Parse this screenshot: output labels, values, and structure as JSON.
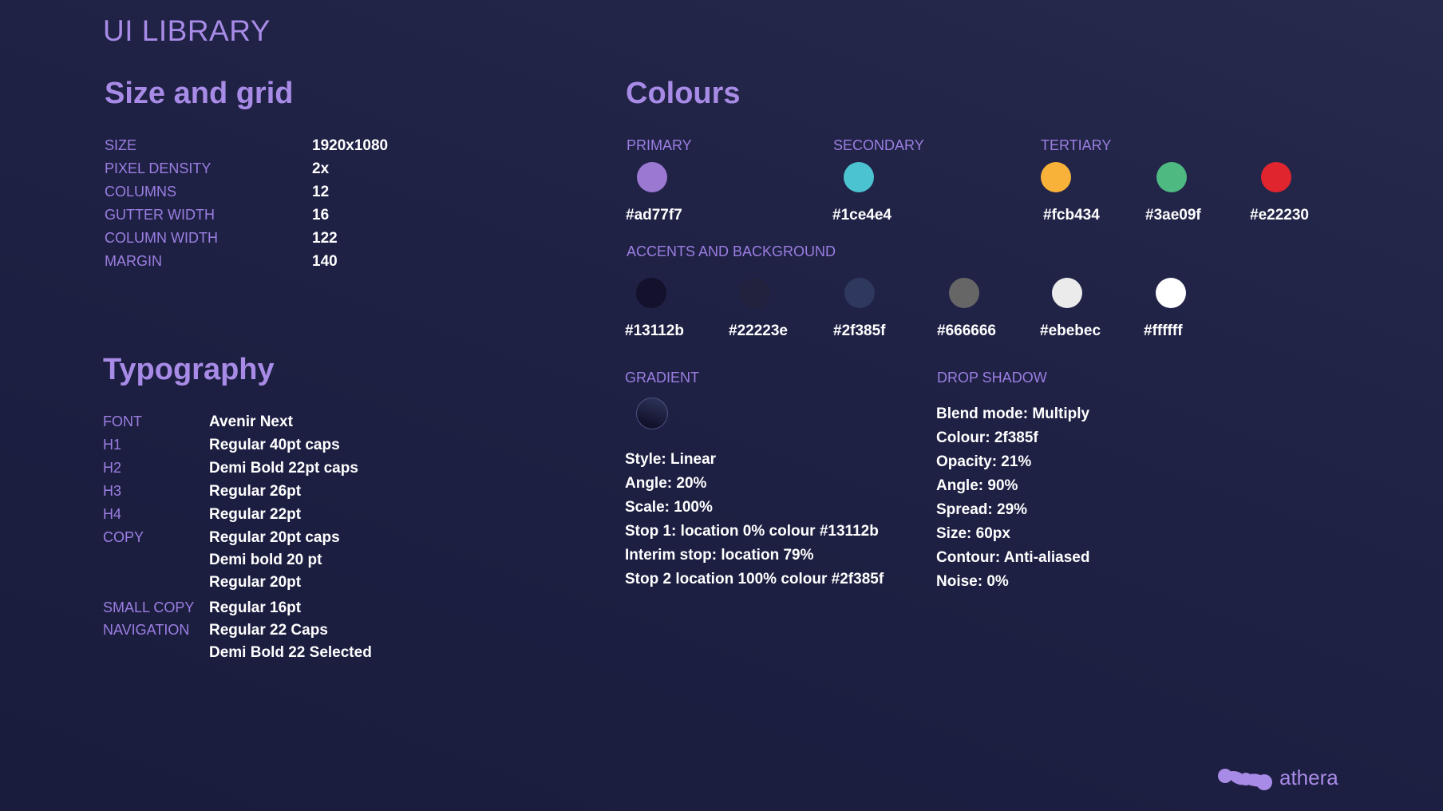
{
  "page_title": "UI LIBRARY",
  "size_grid": {
    "heading": "Size and grid",
    "rows": [
      {
        "label": "SIZE",
        "value": "1920x1080"
      },
      {
        "label": "PIXEL DENSITY",
        "value": "2x"
      },
      {
        "label": "COLUMNS",
        "value": "12"
      },
      {
        "label": "GUTTER WIDTH",
        "value": "16"
      },
      {
        "label": "COLUMN WIDTH",
        "value": "122"
      },
      {
        "label": "MARGIN",
        "value": "140"
      }
    ]
  },
  "typography": {
    "heading": "Typography",
    "rows": [
      {
        "label": "FONT",
        "value": "Avenir Next"
      },
      {
        "label": "H1",
        "value": "Regular 40pt caps"
      },
      {
        "label": "H2",
        "value": "Demi Bold 22pt caps"
      },
      {
        "label": "H3",
        "value": "Regular 26pt"
      },
      {
        "label": "H4",
        "value": "Regular 22pt"
      },
      {
        "label": "COPY",
        "value": "Regular 20pt caps"
      },
      {
        "label": "",
        "value": "Demi bold 20 pt"
      },
      {
        "label": "",
        "value": "Regular 20pt"
      },
      {
        "label": "SMALL COPY",
        "value": "Regular 16pt"
      },
      {
        "label": "NAVIGATION",
        "value": "Regular 22 Caps"
      },
      {
        "label": "",
        "value": "Demi Bold 22 Selected"
      }
    ]
  },
  "colours": {
    "heading": "Colours",
    "primary": {
      "label": "PRIMARY",
      "swatches": [
        {
          "hex": "#ad77f7",
          "color": "#9b78d2"
        }
      ]
    },
    "secondary": {
      "label": "SECONDARY",
      "swatches": [
        {
          "hex": "#1ce4e4",
          "color": "#4cc3d0"
        }
      ]
    },
    "tertiary": {
      "label": "TERTIARY",
      "swatches": [
        {
          "hex": "#fcb434",
          "color": "#f8b23a"
        },
        {
          "hex": "#3ae09f",
          "color": "#4fb982"
        },
        {
          "hex": "#e22230",
          "color": "#e1252e"
        }
      ]
    },
    "accents": {
      "label": "ACCENTS AND BACKGROUND",
      "swatches": [
        {
          "hex": "#13112b",
          "color": "#13112b"
        },
        {
          "hex": "#22223e",
          "color": "#22223e"
        },
        {
          "hex": "#2f385f",
          "color": "#2f385f"
        },
        {
          "hex": "#666666",
          "color": "#666666"
        },
        {
          "hex": "#ebebec",
          "color": "#ebebec"
        },
        {
          "hex": "#ffffff",
          "color": "#ffffff"
        }
      ]
    }
  },
  "gradient": {
    "label": "GRADIENT",
    "from": "#13112b",
    "to": "#2f385f",
    "lines": [
      "Style: Linear",
      "Angle: 20%",
      "Scale: 100%",
      "Stop 1: location 0% colour #13112b",
      "Interim stop: location 79%",
      "Stop 2 location 100% colour #2f385f"
    ]
  },
  "drop_shadow": {
    "label": "DROP SHADOW",
    "lines": [
      "Blend mode: Multiply",
      "Colour: 2f385f",
      "Opacity: 21%",
      "Angle: 90%",
      "Spread: 29%",
      "Size: 60px",
      "Contour: Anti-aliased",
      "Noise: 0%"
    ]
  },
  "brand": {
    "name": "athera",
    "logo_icon": "athera-logo-icon",
    "accent": "#a88be6"
  }
}
